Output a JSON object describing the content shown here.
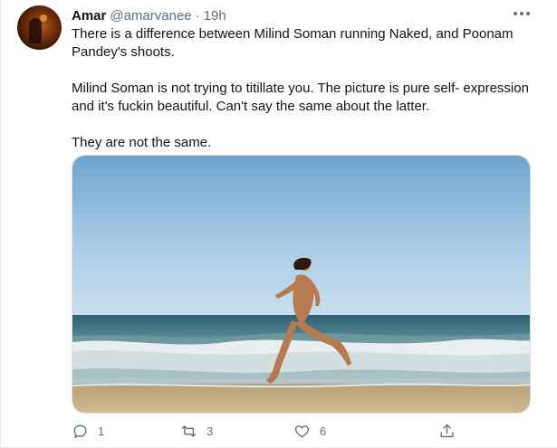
{
  "tweet": {
    "author_name": "Amar",
    "author_handle": "@amarvanee",
    "separator": "·",
    "time": "19h",
    "paragraphs": [
      "There is a difference between Milind Soman running Naked, and Poonam Pandey's shoots.",
      "Milind Soman is not trying to titillate you. The picture is pure self- expression and it's fuckin beautiful. Can't say the same about the latter.",
      "They are not the same."
    ],
    "media_icon": "beach-runner-photo"
  },
  "actions": {
    "reply_count": "1",
    "retweet_count": "3",
    "like_count": "6",
    "icons": [
      "reply-icon",
      "retweet-icon",
      "like-icon",
      "share-icon"
    ]
  },
  "colors": {
    "text": "#0f1419",
    "secondary": "#5b7083",
    "border": "#e6ecf0"
  }
}
